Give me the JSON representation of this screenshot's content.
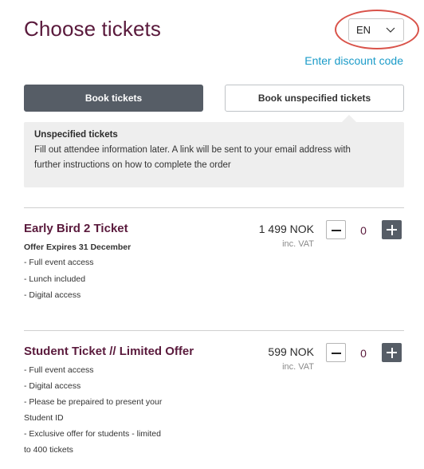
{
  "header": {
    "title": "Choose tickets",
    "language": "EN",
    "discount_link": "Enter discount code"
  },
  "tabs": {
    "book": "Book tickets",
    "unspecified": "Book unspecified tickets"
  },
  "info": {
    "title": "Unspecified tickets",
    "line1": "Fill out attendee information later. A link will be sent to your email address with",
    "line2": "further instructions on how to complete the order"
  },
  "tickets": [
    {
      "name": "Early Bird 2 Ticket",
      "price": "1 499 NOK",
      "vat": "inc. VAT",
      "quantity": "0",
      "lines": [
        "Offer Expires 31 December",
        "- Full event access",
        "- Lunch included",
        "- Digital access"
      ]
    },
    {
      "name": "Student Ticket // Limited Offer",
      "price": "599 NOK",
      "vat": "inc. VAT",
      "quantity": "0",
      "lines": [
        "- Full event access",
        "- Digital access",
        "- Please be prepaired to present your",
        "Student ID",
        "- Exclusive offer for students - limited",
        "to 400 tickets"
      ]
    }
  ],
  "colors": {
    "accent": "#5a1a3c",
    "link": "#1a9bc8",
    "button_dark": "#565d66",
    "highlight_ring": "#d9534a"
  }
}
